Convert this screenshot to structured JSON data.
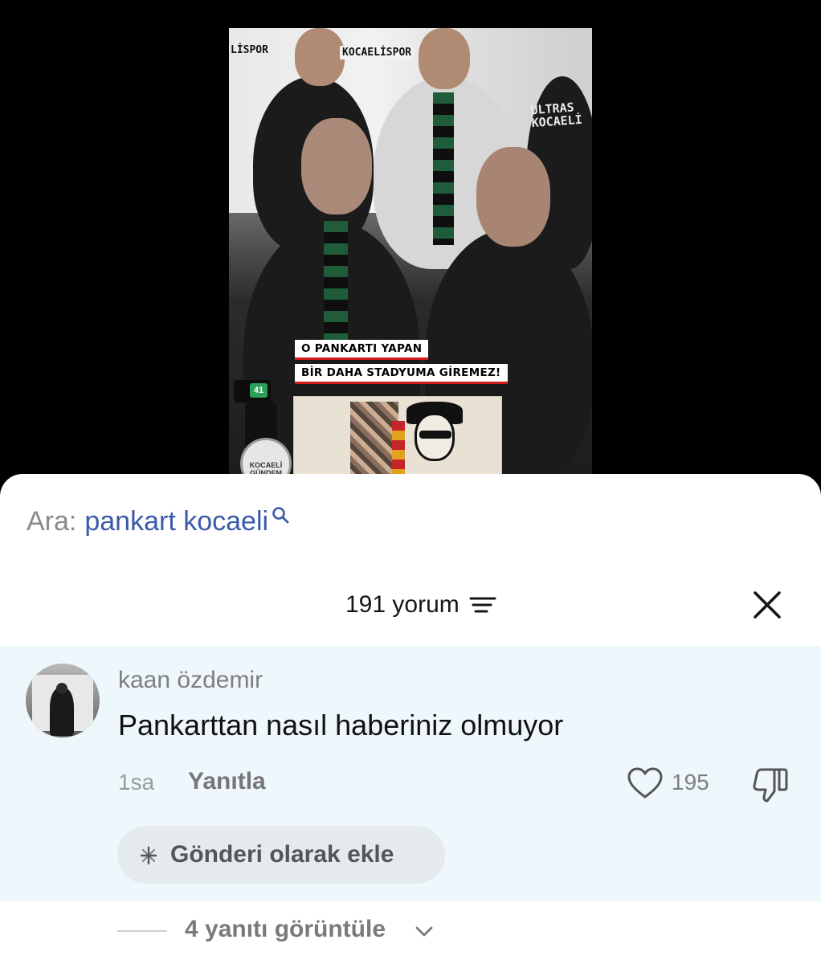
{
  "video": {
    "caption_line1": "O PANKARTI YAPAN",
    "caption_line2": "BİR DAHA STADYUMA GİREMEZ!",
    "logo_text_left": "LİSPOR",
    "logo_text_center": "KOCAELİSPOR",
    "ultras_line1": "ULTRAS",
    "ultras_line2": "KOCAELİ",
    "channel_badge": "41",
    "gundem_label": "KOCAELİ GÜNDEM"
  },
  "search": {
    "prefix": "Ara:",
    "query": "pankart kocaeli",
    "icon": "search-icon"
  },
  "comments": {
    "count_label": "191 yorum",
    "sort_icon": "sort-icon",
    "close_icon": "close-icon"
  },
  "comment": {
    "username": "kaan özdemir",
    "text": "Pankarttan nasıl haberiniz olmuyor",
    "time": "1sa",
    "reply_label": "Yanıtla",
    "like_count": "195",
    "add_post_label": "Gönderi olarak ekle",
    "view_replies_label": "4 yanıtı görüntüle"
  },
  "colors": {
    "accent_link": "#3a5ba8",
    "card_bg": "#eef7fc",
    "caption_red": "#d21d1d"
  }
}
